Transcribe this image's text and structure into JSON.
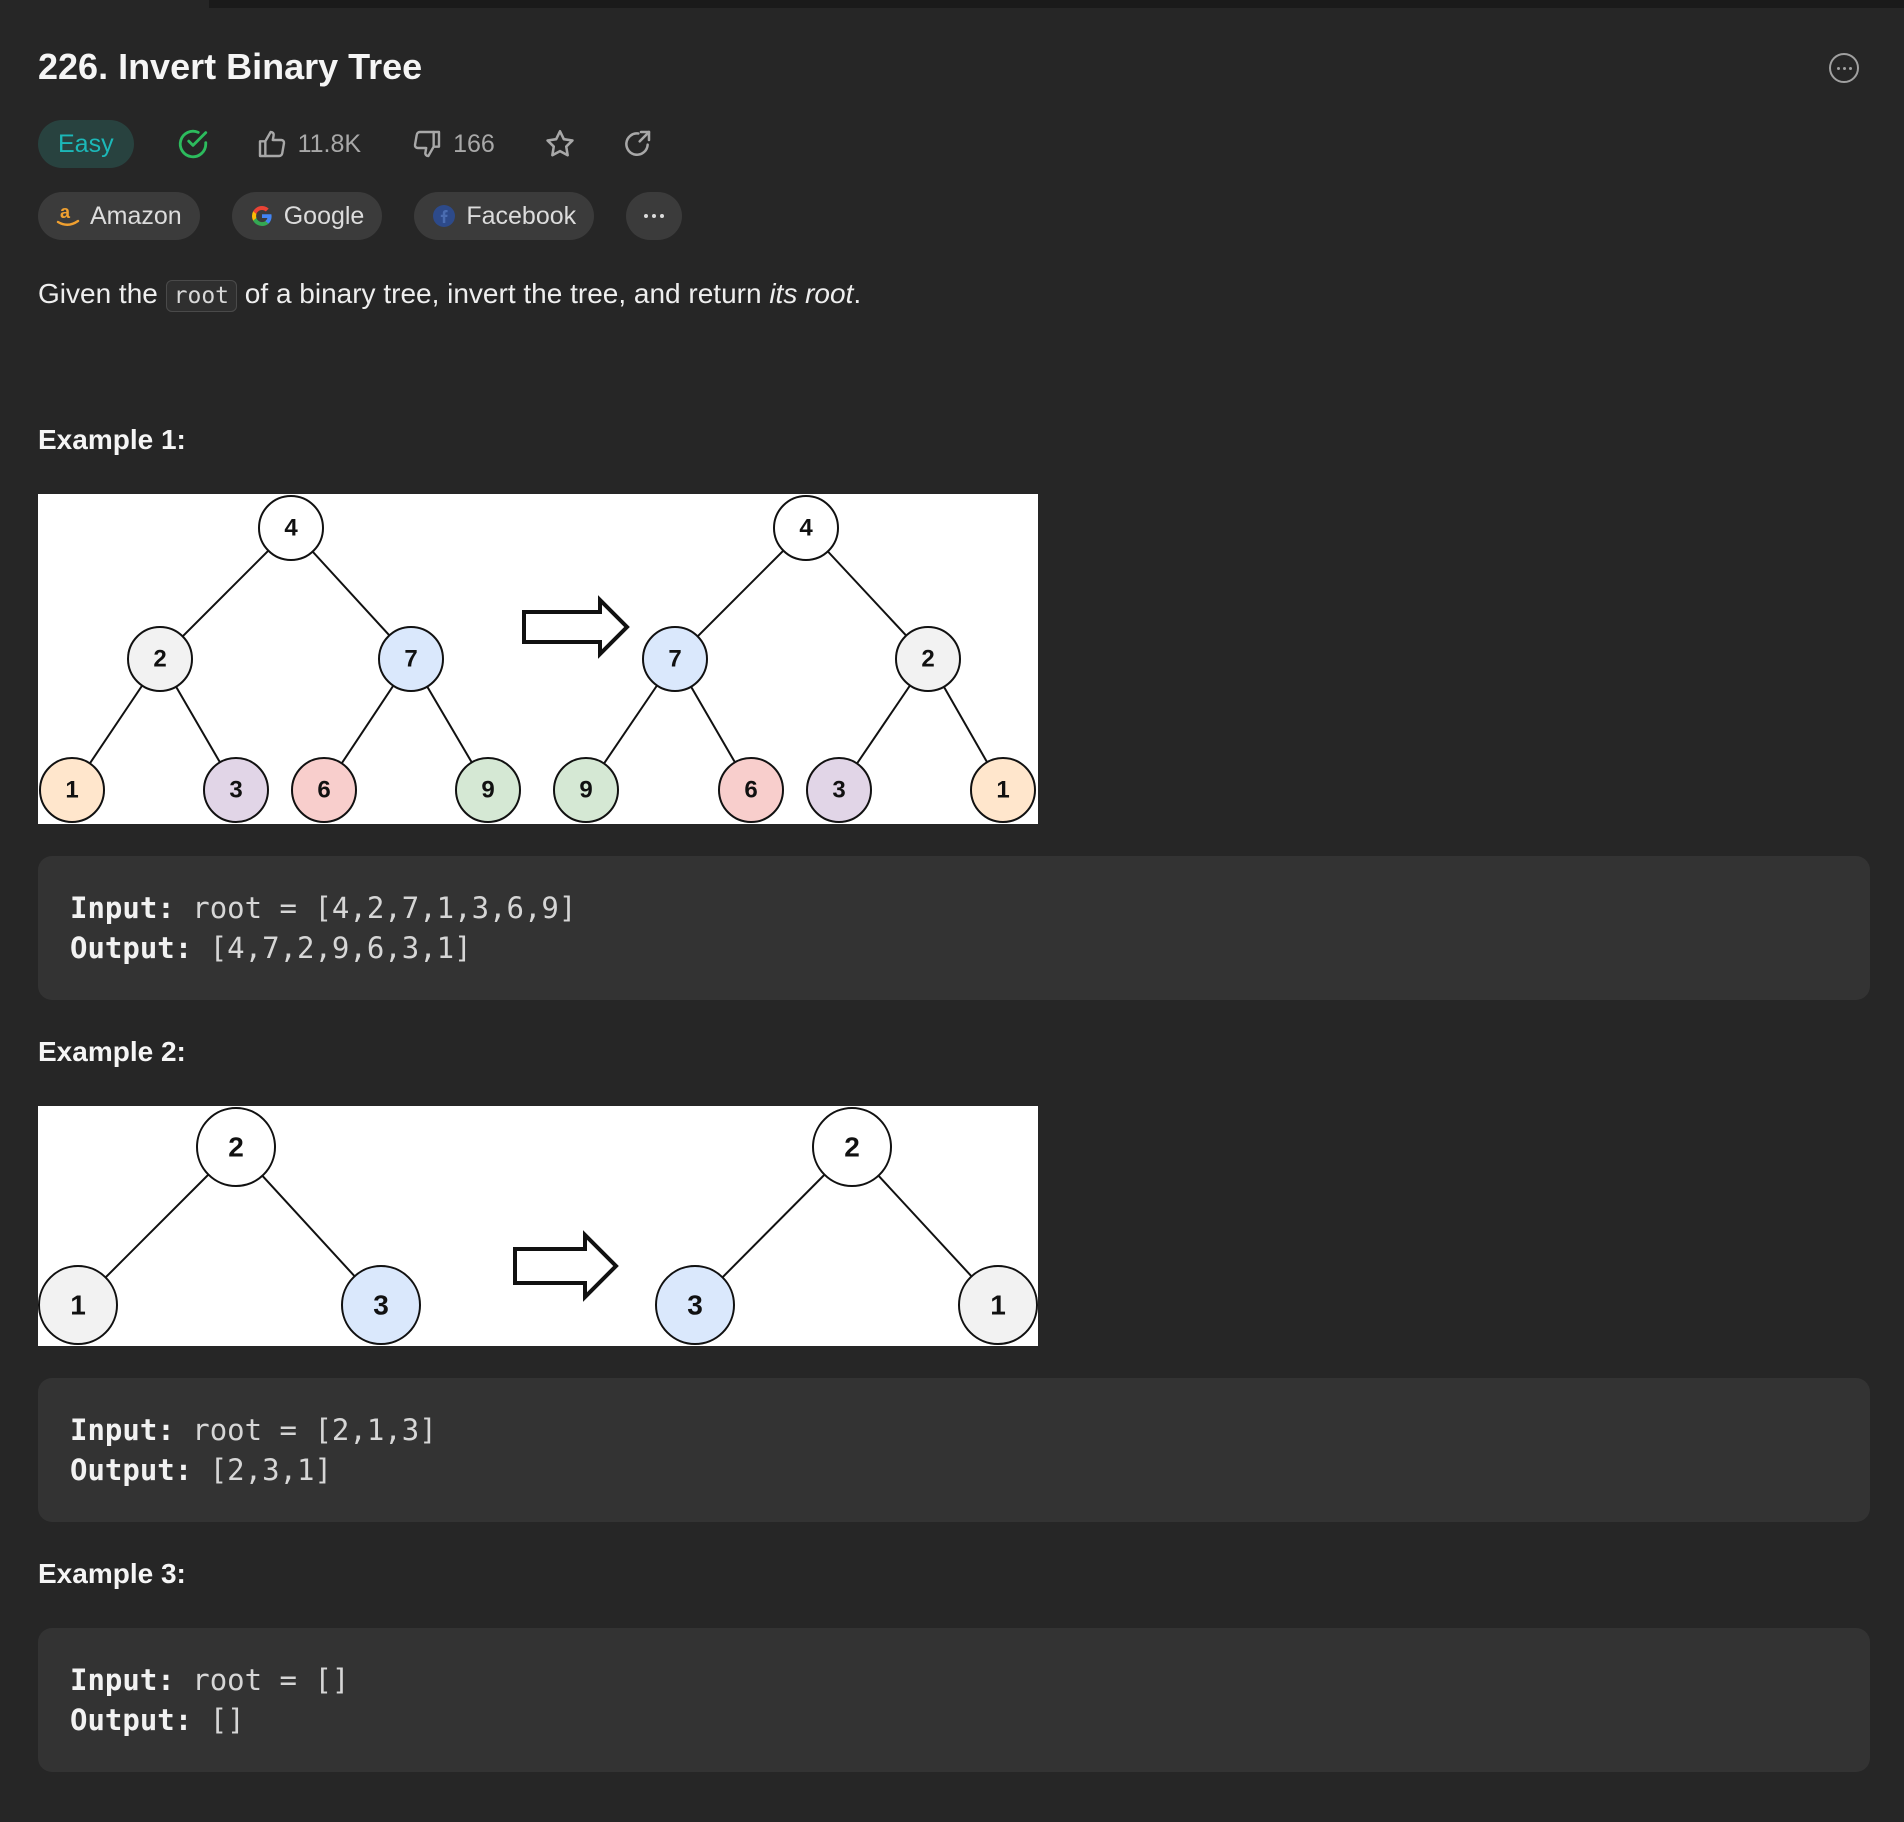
{
  "problem": {
    "title": "226. Invert Binary Tree",
    "difficulty": "Easy",
    "likes": "11.8K",
    "dislikes": "166"
  },
  "companies": [
    {
      "name": "Amazon"
    },
    {
      "name": "Google"
    },
    {
      "name": "Facebook"
    }
  ],
  "description": {
    "before_code": "Given the ",
    "code": "root",
    "middle": " of a binary tree, invert the tree, and return ",
    "italic": "its root",
    "end": "."
  },
  "examples": [
    {
      "title": "Example 1:",
      "input_label": "Input:",
      "input": "root = [4,2,7,1,3,6,9]",
      "output_label": "Output:",
      "output": "[4,7,2,9,6,3,1]",
      "diagram": {
        "left_tree": [
          "4",
          "2",
          "7",
          "1",
          "3",
          "6",
          "9"
        ],
        "right_tree": [
          "4",
          "7",
          "2",
          "9",
          "6",
          "3",
          "1"
        ]
      }
    },
    {
      "title": "Example 2:",
      "input_label": "Input:",
      "input": "root = [2,1,3]",
      "output_label": "Output:",
      "output": "[2,3,1]",
      "diagram": {
        "left_tree": [
          "2",
          "1",
          "3"
        ],
        "right_tree": [
          "2",
          "3",
          "1"
        ]
      }
    },
    {
      "title": "Example 3:",
      "input_label": "Input:",
      "input": "root = []",
      "output_label": "Output:",
      "output": "[]"
    }
  ],
  "colors": {
    "easy": "#1cb8b8",
    "solved_check": "#2cbb5d",
    "node_white": "#ffffff",
    "node_gray": "#f2f2f2",
    "node_blue": "#dae8fc",
    "node_orange": "#ffe6cc",
    "node_purple": "#e1d5e7",
    "node_red": "#f8cecc",
    "node_green": "#d5e8d4"
  },
  "icons": [
    "more-options-icon",
    "solved-check-icon",
    "thumbs-up-icon",
    "thumbs-down-icon",
    "star-icon",
    "share-icon",
    "amazon-icon",
    "google-icon",
    "facebook-icon",
    "more-dots-icon",
    "arrow-right-icon"
  ]
}
